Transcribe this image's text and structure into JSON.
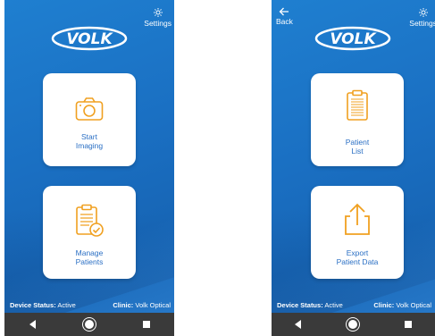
{
  "left_screen": {
    "settings_label": "Settings",
    "cards": [
      {
        "label": "Start\nImaging"
      },
      {
        "label": "Manage\nPatients"
      }
    ],
    "status_label": "Device Status:",
    "status_value": "Active",
    "clinic_label": "Clinic:",
    "clinic_value": "Volk Optical"
  },
  "right_screen": {
    "back_label": "Back",
    "settings_label": "Settings",
    "cards": [
      {
        "label": "Patient\nList"
      },
      {
        "label": "Export\nPatient Data"
      }
    ],
    "status_label": "Device Status:",
    "status_value": "Active",
    "clinic_label": "Clinic:",
    "clinic_value": "Volk Optical"
  },
  "logo_text": "VOLK",
  "colors": {
    "background": "#1a6fc2",
    "card_label": "#2a6fc4",
    "icon_orange": "#f0a020",
    "navbar": "#3a3a3a"
  },
  "icons": {
    "settings": "gear-icon",
    "back": "arrow-left-icon",
    "start_imaging": "camera-icon",
    "manage_patients": "clipboard-check-icon",
    "patient_list": "clipboard-icon",
    "export": "export-icon"
  }
}
